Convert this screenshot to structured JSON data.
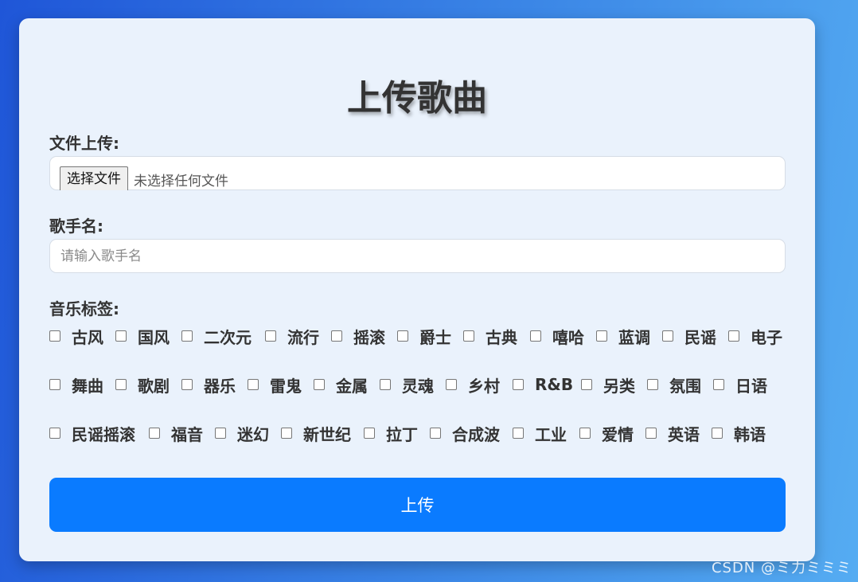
{
  "form": {
    "title": "上传歌曲",
    "file_label": "文件上传:",
    "file_button": "选择文件",
    "file_status": "未选择任何文件",
    "singer_label": "歌手名:",
    "singer_placeholder": "请输入歌手名",
    "singer_value": "",
    "tags_label": "音乐标签:",
    "submit_label": "上传"
  },
  "tag_rows": [
    [
      "古风",
      "国风",
      "二次元",
      "流行",
      "摇滚",
      "爵士",
      "古典",
      "嘻哈",
      "蓝调",
      "民谣",
      "电子"
    ],
    [
      "舞曲",
      "歌剧",
      "器乐",
      "雷鬼",
      "金属",
      "灵魂",
      "乡村",
      "R&B",
      "另类",
      "氛围",
      "日语"
    ],
    [
      "民谣摇滚",
      "福音",
      "迷幻",
      "新世纪",
      "拉丁",
      "合成波",
      "工业",
      "爱情",
      "英语",
      "韩语"
    ]
  ],
  "watermark": "CSDN @ミ力ミミミ"
}
